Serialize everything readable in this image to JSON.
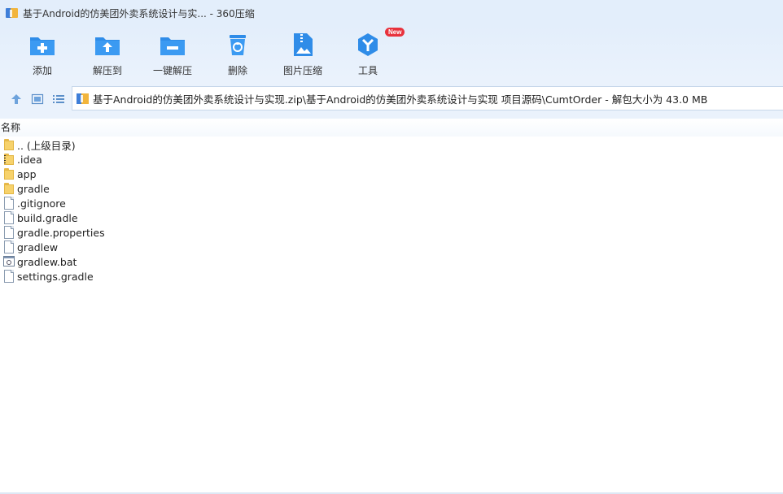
{
  "window": {
    "title": "基于Android的仿美团外卖系统设计与实... - 360压缩"
  },
  "toolbar": {
    "buttons": [
      {
        "label": "添加",
        "icon": "add-folder-icon"
      },
      {
        "label": "解压到",
        "icon": "extract-to-icon"
      },
      {
        "label": "一键解压",
        "icon": "one-click-extract-icon"
      },
      {
        "label": "删除",
        "icon": "trash-icon"
      },
      {
        "label": "图片压缩",
        "icon": "image-compress-icon"
      },
      {
        "label": "工具",
        "icon": "tools-icon",
        "badge": "New"
      }
    ]
  },
  "address": {
    "path": "基于Android的仿美团外卖系统设计与实现.zip\\基于Android的仿美团外卖系统设计与实现 项目源码\\CumtOrder - 解包大小为 43.0 MB"
  },
  "list": {
    "column_name": "名称",
    "items": [
      {
        "name": ".. (上级目录)",
        "type": "parent-folder"
      },
      {
        "name": ".idea",
        "type": "folder"
      },
      {
        "name": "app",
        "type": "folder"
      },
      {
        "name": "gradle",
        "type": "folder"
      },
      {
        "name": ".gitignore",
        "type": "file"
      },
      {
        "name": "build.gradle",
        "type": "file"
      },
      {
        "name": "gradle.properties",
        "type": "file"
      },
      {
        "name": "gradlew",
        "type": "file"
      },
      {
        "name": "gradlew.bat",
        "type": "batch-file"
      },
      {
        "name": "settings.gradle",
        "type": "file"
      }
    ]
  },
  "colors": {
    "accent": "#2f8ce8",
    "toolbar_bg": "#e3eefb",
    "badge": "#e8323d"
  }
}
